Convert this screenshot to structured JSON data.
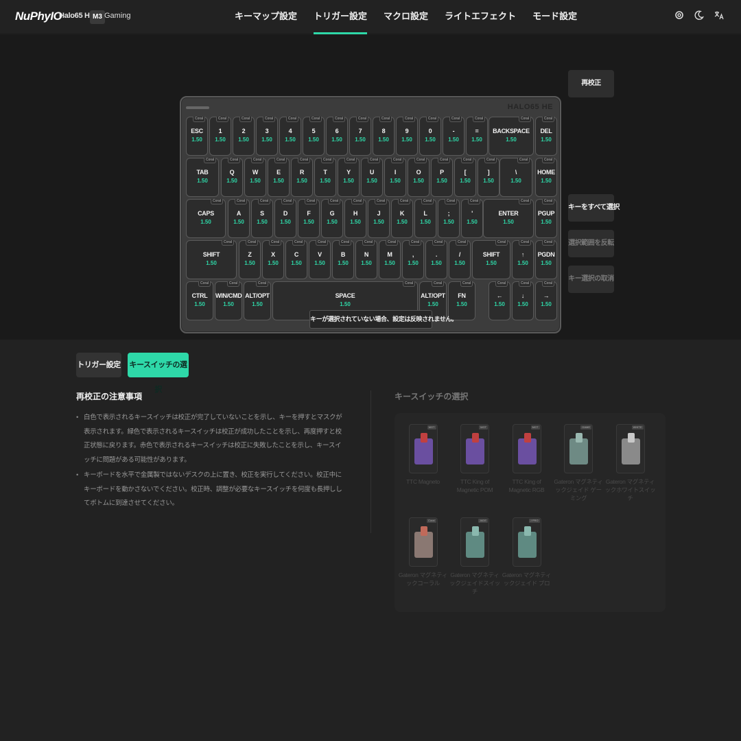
{
  "app": {
    "logo": "NuPhyIO",
    "model": "Halo65 HE",
    "mode_badge": "M3",
    "mode_name": "Gaming"
  },
  "nav": {
    "items": [
      {
        "label": "キーマップ設定",
        "active": false
      },
      {
        "label": "トリガー設定",
        "active": true
      },
      {
        "label": "マクロ設定",
        "active": false
      },
      {
        "label": "ライトエフェクト",
        "active": false
      },
      {
        "label": "モード設定",
        "active": false
      }
    ]
  },
  "top_icons": [
    "settings-icon",
    "moon-icon",
    "translate-icon"
  ],
  "keyboard": {
    "brand": "HALO65 HE",
    "switch_tag": "Coral",
    "value": "1.50",
    "rows": [
      [
        "ESC",
        "1",
        "2",
        "3",
        "4",
        "5",
        "6",
        "7",
        "8",
        "9",
        "0",
        "-",
        "=",
        "BACKSPACE",
        "DEL"
      ],
      [
        "TAB",
        "Q",
        "W",
        "E",
        "R",
        "T",
        "Y",
        "U",
        "I",
        "O",
        "P",
        "[",
        "]",
        "\\",
        "HOME"
      ],
      [
        "CAPS",
        "A",
        "S",
        "D",
        "F",
        "G",
        "H",
        "J",
        "K",
        "L",
        ";",
        "'",
        "ENTER",
        "PGUP"
      ],
      [
        "SHIFT",
        "Z",
        "X",
        "C",
        "V",
        "B",
        "N",
        "M",
        ",",
        ".",
        "/",
        "SHIFT",
        "↑",
        "PGDN"
      ],
      [
        "CTRL",
        "WIN/CMD",
        "ALT/OPT",
        "SPACE",
        "ALT/OPT",
        "FN",
        "←",
        "↓",
        "→"
      ]
    ]
  },
  "side_buttons": {
    "recalibrate": "再校正",
    "select_all": "キーをすべて選択",
    "invert": "選択範囲を反転",
    "deselect": "キー選択の取消"
  },
  "notice": "キーが選択されていない場合、設定は反映されません。",
  "tabs": {
    "trigger": "トリガー設定",
    "switch_select": "キースイッチの選択"
  },
  "notes": {
    "title": "再校正の注意事項",
    "items": [
      "白色で表示されるキースイッチは校正が完了していないことを示し、キーを押すとマスクが表示されます。緑色で表示されるキースイッチは校正が成功したことを示し、再度押すと校正状態に戻ります。赤色で表示されるキースイッチは校正に失敗したことを示し、キースイッチに問題がある可能性があります。",
      "キーボードを水平で金属製ではないデスクの上に置き、校正を実行してください。校正中にキーボードを動かさないでください。校正時、調整が必要なキースイッチを何度も長押ししてボトムに到達させてください。"
    ]
  },
  "switches": {
    "title": "キースイッチの選択",
    "items": [
      {
        "name": "TTC Magneto",
        "tag": "MGT",
        "color": "#6a4fa0",
        "stem": "#c04040"
      },
      {
        "name": "TTC King of Magnetic POM",
        "tag": "MGT",
        "color": "#6a4fa0",
        "stem": "#c04040"
      },
      {
        "name": "TTC King of Magnetic RGB",
        "tag": "MGT",
        "color": "#6a4fa0",
        "stem": "#c04040"
      },
      {
        "name": "Gateron マグネティックジェイド ゲーミング",
        "tag": "GAME",
        "color": "#6e8a84",
        "stem": "#9ab8b0"
      },
      {
        "name": "Gateron マグネティックホワイトスイッチ",
        "tag": "WHITE",
        "color": "#8a8a8a",
        "stem": "#c8c8c8"
      },
      {
        "name": "Gateron マグネティックコーラル",
        "tag": "Coral",
        "color": "#8a7872",
        "stem": "#c06a5a"
      },
      {
        "name": "Gateron マグネティックジェイドスイッチ",
        "tag": "JADE",
        "color": "#5f8a82",
        "stem": "#8ab8ae"
      },
      {
        "name": "Gateron マグネティックジェイド プロ",
        "tag": "J PRO",
        "color": "#5f8a82",
        "stem": "#8ab8ae"
      }
    ]
  }
}
